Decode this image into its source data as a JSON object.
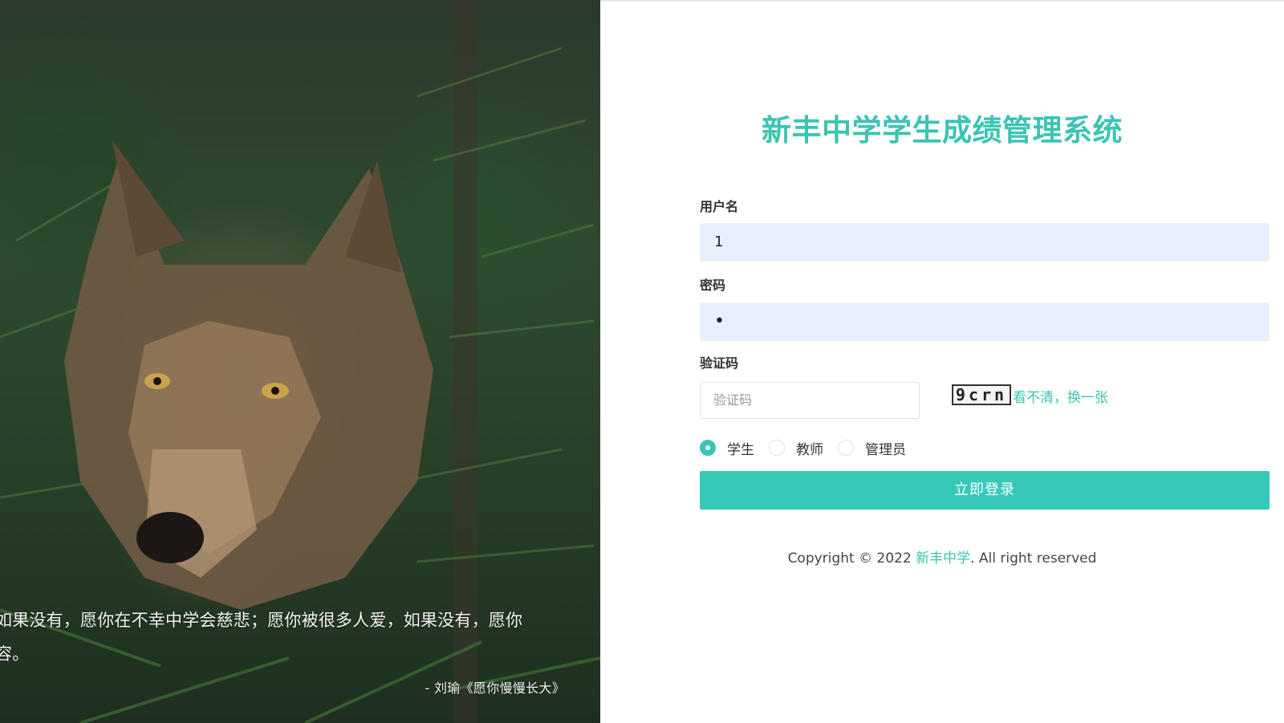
{
  "hero": {
    "quote_line1": "如果没有，愿你在不幸中学会慈悲；愿你被很多人爱，如果没有，愿你",
    "quote_line2": "容。",
    "quote_author": "- 刘瑜《愿你慢慢长大》"
  },
  "login": {
    "title": "新丰中学学生成绩管理系统",
    "username_label": "用户名",
    "username_value": "1",
    "password_label": "密码",
    "password_mask": "•",
    "captcha_label": "验证码",
    "captcha_placeholder": "验证码",
    "captcha_image_text": "9crn",
    "captcha_refresh": "看不清，换一张",
    "roles": [
      {
        "label": "学生",
        "checked": true
      },
      {
        "label": "教师",
        "checked": false
      },
      {
        "label": "管理员",
        "checked": false
      }
    ],
    "submit_label": "立即登录"
  },
  "footer": {
    "prefix": "Copyright © 2022 ",
    "brand": "新丰中学",
    "suffix": ". All right reserved"
  },
  "colors": {
    "accent": "#3ac4b3",
    "input_bg": "#e8f0fe"
  }
}
